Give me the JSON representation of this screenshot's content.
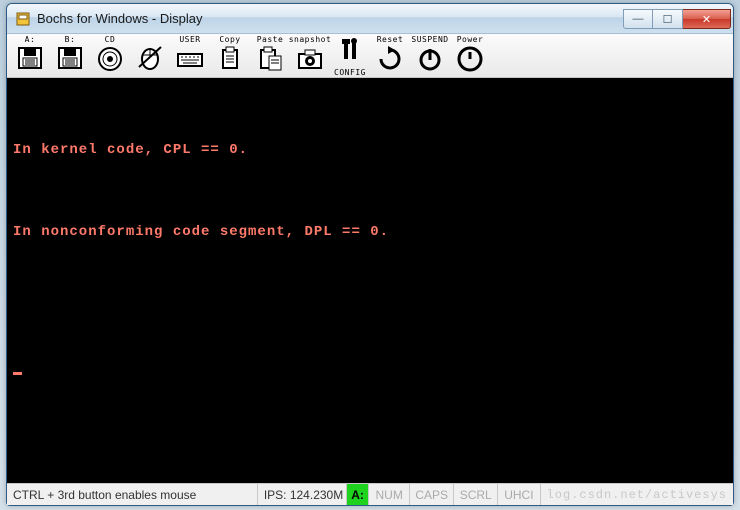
{
  "window": {
    "title": "Bochs for Windows - Display",
    "buttons": {
      "min": "—",
      "max": "☐",
      "close": "✕"
    }
  },
  "toolbar": [
    {
      "name": "floppy-a-button",
      "caption": "A:"
    },
    {
      "name": "floppy-b-button",
      "caption": "B:"
    },
    {
      "name": "cdrom-button",
      "caption": "CD"
    },
    {
      "name": "mouse-button",
      "caption": ""
    },
    {
      "name": "user-button",
      "caption": "USER"
    },
    {
      "name": "copy-button",
      "caption": "Copy"
    },
    {
      "name": "paste-button",
      "caption": "Paste"
    },
    {
      "name": "snapshot-button",
      "caption": "snapshot"
    },
    {
      "name": "config-button",
      "caption": "CONFIG"
    },
    {
      "name": "reset-button",
      "caption": "Reset"
    },
    {
      "name": "suspend-button",
      "caption": "SUSPEND"
    },
    {
      "name": "power-button",
      "caption": "Power"
    }
  ],
  "terminal": {
    "line1": "In kernel code, CPL == 0.",
    "line2": "In nonconforming code segment, DPL == 0."
  },
  "status": {
    "hint": "CTRL + 3rd button enables mouse",
    "ips": "IPS: 124.230M",
    "drive": "A:",
    "ind1": "NUM",
    "ind2": "CAPS",
    "ind3": "SCRL",
    "ind4": "UHCI",
    "watermark": "log.csdn.net/activesys"
  }
}
